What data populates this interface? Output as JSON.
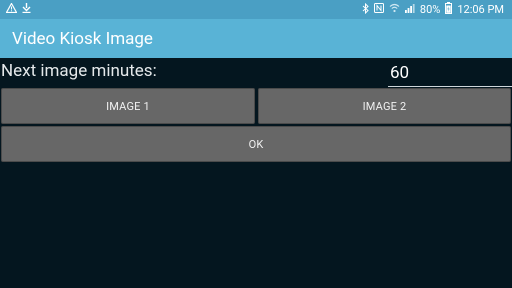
{
  "status_bar": {
    "battery": "80%",
    "time": "12:06 PM"
  },
  "app_bar": {
    "title": "Video Kiosk Image"
  },
  "form": {
    "minutes_label": "Next image minutes:",
    "minutes_value": "60"
  },
  "buttons": {
    "image1": "IMAGE 1",
    "image2": "IMAGE 2",
    "ok": "OK"
  },
  "colors": {
    "status_bar": "#4a9fc4",
    "app_bar": "#59b3d6",
    "background": "#04161f",
    "button": "#676767"
  }
}
